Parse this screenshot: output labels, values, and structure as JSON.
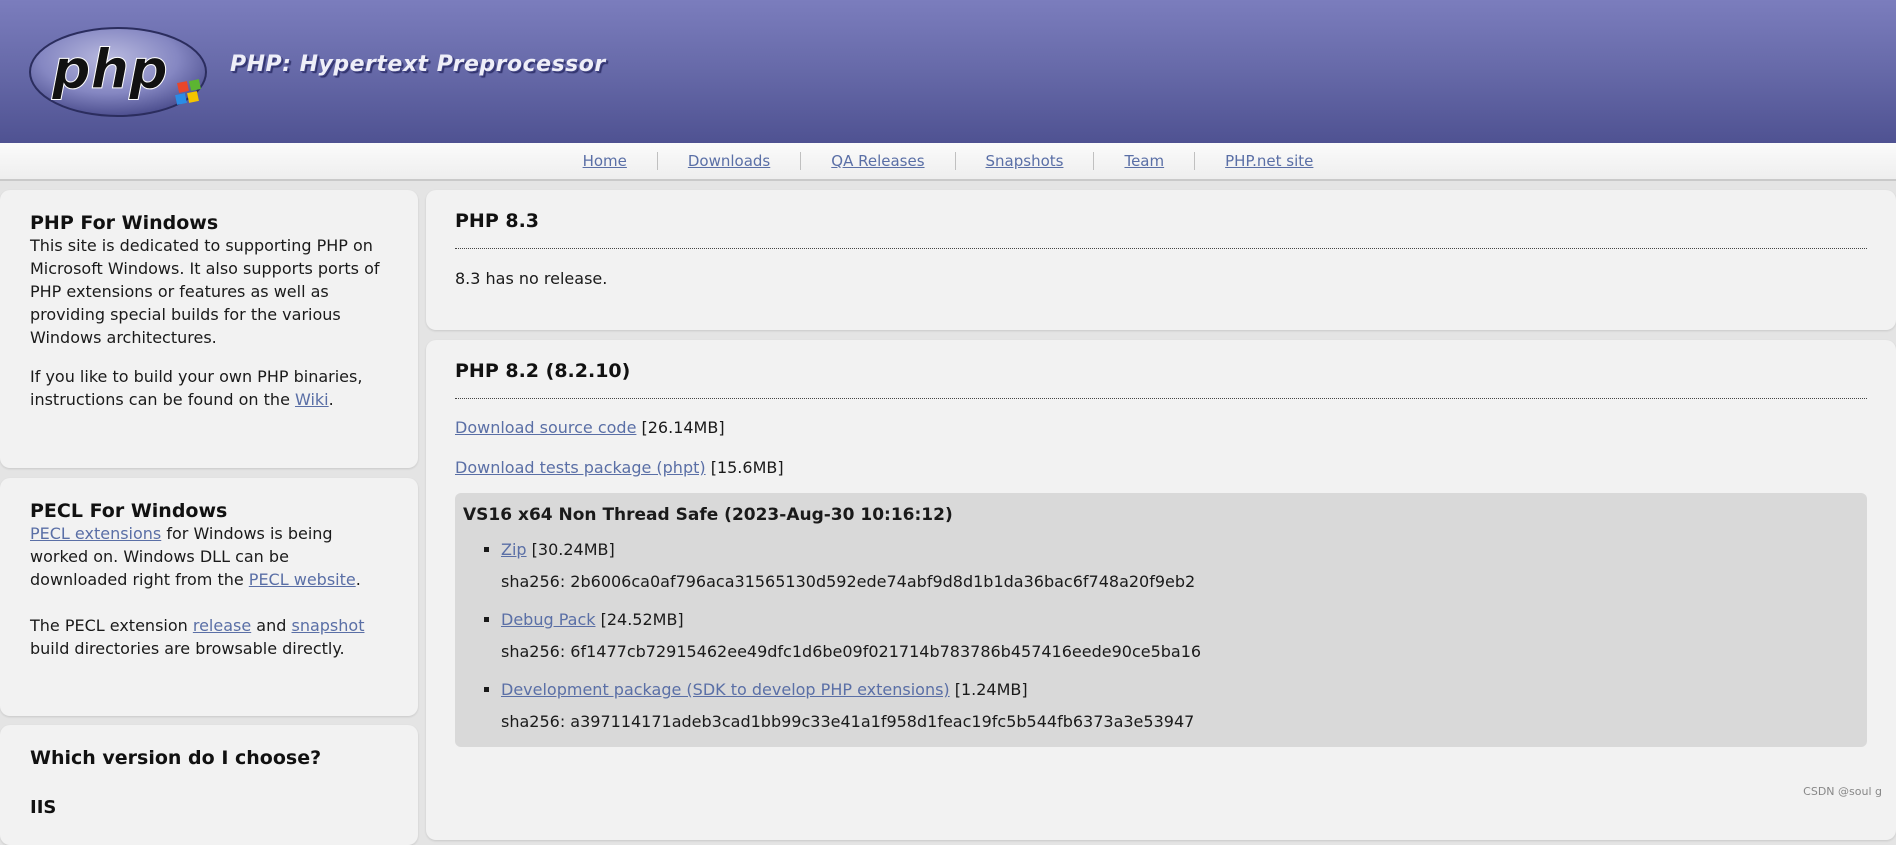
{
  "header": {
    "logo_text": "php",
    "tagline": "PHP: Hypertext Preprocessor"
  },
  "nav": {
    "items": [
      "Home",
      "Downloads",
      "QA Releases",
      "Snapshots",
      "Team",
      "PHP.net site"
    ]
  },
  "sidebar": {
    "windows": {
      "title": "PHP For Windows",
      "p1": "This site is dedicated to supporting PHP on Microsoft Windows. It also supports ports of PHP extensions or features as well as providing special builds for the various Windows architectures.",
      "p2_pre": "If you like to build your own PHP binaries, instructions can be found on the ",
      "p2_link": "Wiki",
      "p2_post": "."
    },
    "pecl": {
      "title": "PECL For Windows",
      "p1_link": "PECL extensions",
      "p1_mid": " for Windows is being worked on. Windows DLL can be downloaded right from the ",
      "p1_link2": "PECL website",
      "p1_post": ".",
      "p2_pre": "The PECL extension ",
      "p2_link1": "release",
      "p2_mid": " and ",
      "p2_link2": "snapshot",
      "p2_post": " build directories are browsable directly."
    },
    "which": {
      "title": "Which version do I choose?",
      "sub": "IIS"
    }
  },
  "main": {
    "php83": {
      "title": "PHP 8.3",
      "text": "8.3 has no release."
    },
    "php82": {
      "title": "PHP 8.2 (8.2.10)",
      "source_link": "Download source code",
      "source_size": " [26.14MB]",
      "tests_link": "Download tests package (phpt)",
      "tests_size": " [15.6MB]",
      "build": {
        "title": "VS16 x64 Non Thread Safe (2023-Aug-30 10:16:12)",
        "items": [
          {
            "link": "Zip",
            "size": " [30.24MB]",
            "sha": "sha256: 2b6006ca0af796aca31565130d592ede74abf9d8d1b1da36bac6f748a20f9eb2"
          },
          {
            "link": "Debug Pack",
            "size": " [24.52MB]",
            "sha": "sha256: 6f1477cb72915462ee49dfc1d6be09f021714b783786b457416eede90ce5ba16"
          },
          {
            "link": "Development package (SDK to develop PHP extensions)",
            "size": " [1.24MB]",
            "sha": "sha256: a397114171adeb3cad1bb99c33e41a1f958d1feac19fc5b544fb6373a3e53947"
          }
        ]
      }
    }
  },
  "watermark": "CSDN @soul g",
  "colors": {
    "header_top": "#7b7dbd",
    "header_bottom": "#4f5292",
    "link": "#5a6fa6",
    "panel_bg": "#f2f2f2",
    "build_bg": "#d9d9d9"
  }
}
